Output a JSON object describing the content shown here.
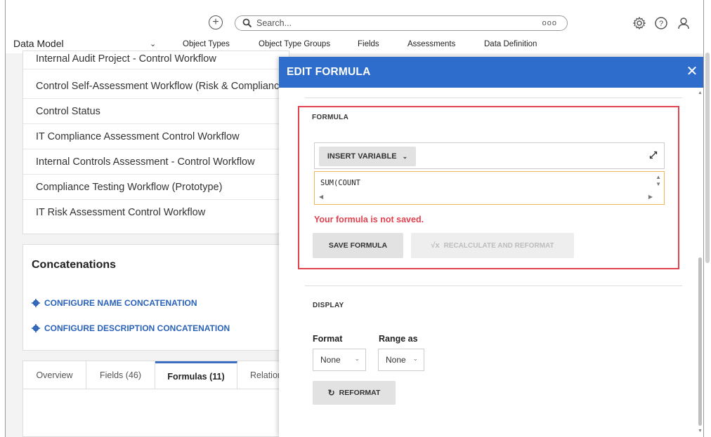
{
  "topbar": {
    "search_placeholder": "Search...",
    "more_label": "ooo"
  },
  "nav": {
    "data_model_label": "Data Model",
    "tabs": [
      {
        "label": "Object Types",
        "active": true
      },
      {
        "label": "Object Type Groups",
        "active": false
      },
      {
        "label": "Fields",
        "active": false
      },
      {
        "label": "Assessments",
        "active": false
      },
      {
        "label": "Data Definition",
        "active": false
      }
    ]
  },
  "workflow_list": {
    "items": [
      "Internal Audit Project - Control Workflow",
      "Control Self-Assessment Workflow (Risk & Compliance)",
      "Control Status",
      "IT Compliance Assessment Control Workflow",
      "Internal Controls Assessment - Control Workflow",
      "Compliance Testing Workflow (Prototype)",
      "IT Risk Assessment Control Workflow"
    ]
  },
  "concatenations": {
    "title": "Concatenations",
    "name_link": "CONFIGURE NAME CONCATENATION",
    "description_link": "CONFIGURE DESCRIPTION CONCATENATION"
  },
  "bottom_tabs": {
    "tabs": [
      {
        "label": "Overview",
        "active": false
      },
      {
        "label": "Fields (46)",
        "active": false
      },
      {
        "label": "Formulas (11)",
        "active": true
      },
      {
        "label": "Relationships",
        "active": false
      }
    ]
  },
  "modal": {
    "title": "EDIT FORMULA",
    "close_label": "✕",
    "formula_section_label": "FORMULA",
    "insert_variable_label": "INSERT VARIABLE",
    "formula_text": "SUM(COUNT",
    "error_message": "Your formula is not saved.",
    "save_formula_label": "SAVE FORMULA",
    "recalculate_label": "RECALCULATE AND REFORMAT",
    "display_section_label": "DISPLAY",
    "format_label": "Format",
    "format_value": "None",
    "range_label": "Range as",
    "range_value": "None",
    "reformat_label": "REFORMAT"
  },
  "colors": {
    "header_blue": "#2e6dcb",
    "link_blue": "#2a62b9",
    "error_red": "#e2414e",
    "editor_focus": "#f0b75a"
  }
}
